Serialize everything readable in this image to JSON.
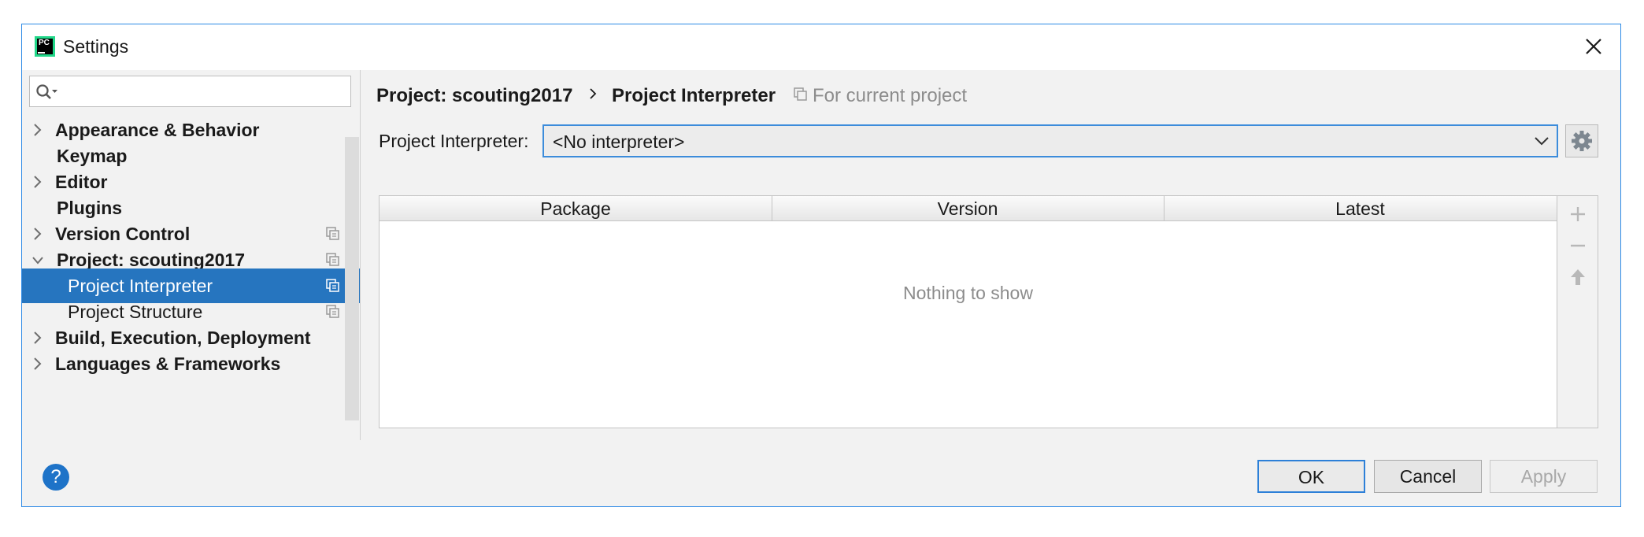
{
  "window": {
    "title": "Settings",
    "app_icon_text": "PC"
  },
  "sidebar": {
    "search_placeholder": "",
    "items": [
      {
        "label": "Appearance & Behavior",
        "expandable": true,
        "expanded": false,
        "bold": true
      },
      {
        "label": "Keymap",
        "expandable": false,
        "bold": true
      },
      {
        "label": "Editor",
        "expandable": true,
        "expanded": false,
        "bold": true
      },
      {
        "label": "Plugins",
        "expandable": false,
        "bold": true
      },
      {
        "label": "Version Control",
        "expandable": true,
        "expanded": false,
        "bold": true,
        "project_icon": true
      },
      {
        "label": "Project: scouting2017",
        "expandable": true,
        "expanded": true,
        "bold": true,
        "project_icon": true
      },
      {
        "label": "Project Interpreter",
        "child": true,
        "selected": true,
        "project_icon": true
      },
      {
        "label": "Project Structure",
        "child": true,
        "project_icon": true
      },
      {
        "label": "Build, Execution, Deployment",
        "expandable": true,
        "expanded": false,
        "bold": true
      },
      {
        "label": "Languages & Frameworks",
        "expandable": true,
        "expanded": false,
        "bold": true
      }
    ]
  },
  "breadcrumb": {
    "project": "Project: scouting2017",
    "page": "Project Interpreter",
    "scope_note": "For current project"
  },
  "interpreter": {
    "label": "Project Interpreter:",
    "value": "<No interpreter>"
  },
  "packages_table": {
    "columns": [
      "Package",
      "Version",
      "Latest"
    ],
    "rows": [],
    "empty_text": "Nothing to show"
  },
  "buttons": {
    "help": "?",
    "ok": "OK",
    "cancel": "Cancel",
    "apply": "Apply"
  },
  "colors": {
    "selection": "#2675bf",
    "focus_border": "#3c8cdb",
    "window_border": "#2d8ae6"
  }
}
